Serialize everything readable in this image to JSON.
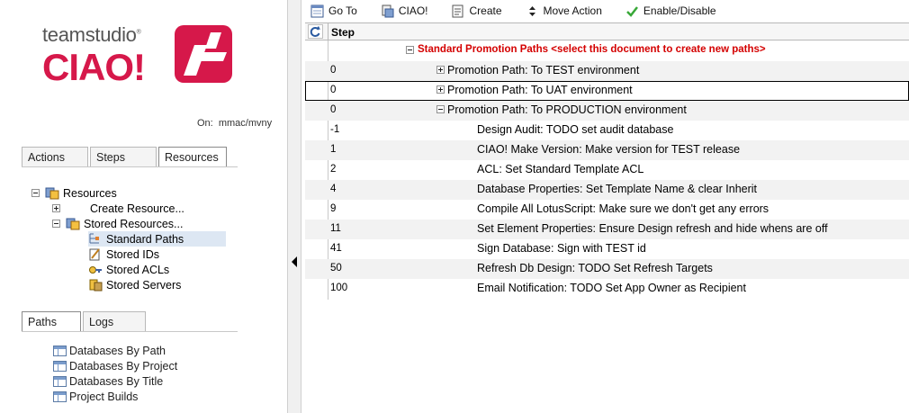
{
  "brand": {
    "company": "teamstudio",
    "product": "CIAO!",
    "registered": "®"
  },
  "server": {
    "label": "On:",
    "value": "mmac/mvny"
  },
  "left_tabs": [
    {
      "label": "Actions",
      "active": false
    },
    {
      "label": "Steps",
      "active": false
    },
    {
      "label": "Resources",
      "active": true
    }
  ],
  "resources_tree": {
    "root": "Resources",
    "create": "Create Resource...",
    "stored": "Stored Resources...",
    "children": [
      "Standard Paths",
      "Stored IDs",
      "Stored ACLs",
      "Stored Servers"
    ],
    "selected": "Standard Paths"
  },
  "bottom_tabs": [
    {
      "label": "Paths",
      "active": true
    },
    {
      "label": "Logs",
      "active": false
    }
  ],
  "views": [
    "Databases By Path",
    "Databases By Project",
    "Databases By Title",
    "Project Builds"
  ],
  "toolbar": [
    {
      "label": "Go To",
      "icon": "goto-icon"
    },
    {
      "label": "CIAO!",
      "icon": "ciao-icon"
    },
    {
      "label": "Create",
      "icon": "create-icon"
    },
    {
      "label": "Move Action",
      "icon": "move-icon"
    },
    {
      "label": "Enable/Disable",
      "icon": "checkmark-icon"
    }
  ],
  "grid": {
    "column": "Step",
    "category": "Standard Promotion Paths <select this document to create new paths>",
    "rows": [
      {
        "step": "0",
        "kind": "path",
        "text": "Promotion Path: To TEST environment",
        "expanded": false
      },
      {
        "step": "0",
        "kind": "path",
        "text": "Promotion Path: To UAT environment",
        "expanded": false
      },
      {
        "step": "0",
        "kind": "path",
        "text": "Promotion Path: To PRODUCTION environment",
        "expanded": true
      },
      {
        "step": "-1",
        "kind": "audit",
        "text": "Design Audit: TODO set audit database"
      },
      {
        "step": "1",
        "kind": "ciao",
        "text": "CIAO! Make Version: Make version for TEST release"
      },
      {
        "step": "2",
        "kind": "acl",
        "text": "ACL: Set Standard Template ACL"
      },
      {
        "step": "4",
        "kind": "dbprop",
        "text": "Database Properties: Set Template Name & clear Inherit"
      },
      {
        "step": "9",
        "kind": "compile",
        "text": "Compile All LotusScript: Make sure we don't get any errors"
      },
      {
        "step": "11",
        "kind": "element",
        "text": "Set Element Properties: Ensure Design refresh and hide whens are off"
      },
      {
        "step": "41",
        "kind": "sign",
        "text": "Sign Database: Sign with TEST id"
      },
      {
        "step": "50",
        "kind": "refresh",
        "text": "Refresh Db Design: TODO Set Refresh Targets"
      },
      {
        "step": "100",
        "kind": "email",
        "text": "Email Notification: TODO Set App Owner as Recipient"
      }
    ]
  },
  "colors": {
    "brand": "#d6184a",
    "category": "#d40000",
    "row_shade": "#f2f2f2",
    "selection": "#dde7f3"
  }
}
